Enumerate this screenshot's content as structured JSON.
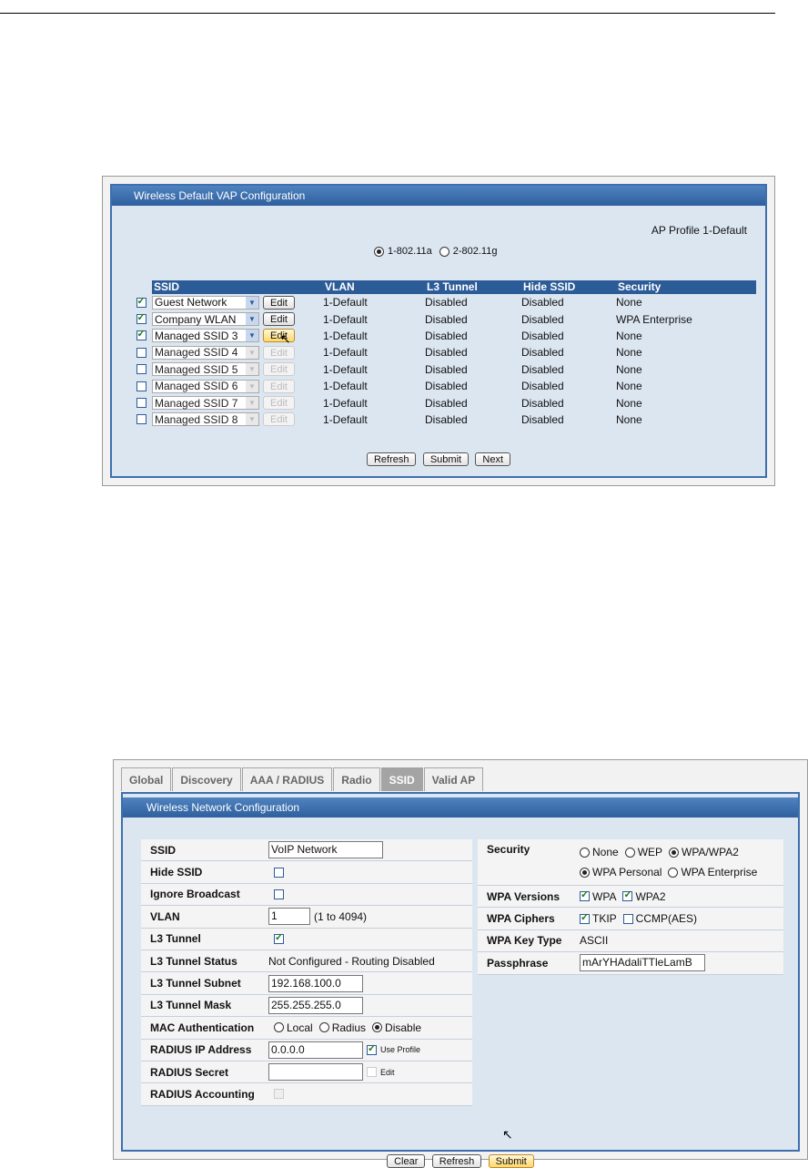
{
  "vap": {
    "title": "Wireless Default VAP Configuration",
    "ap_profile": "AP Profile 1-Default",
    "radio_a": "1-802.11a",
    "radio_g": "2-802.11g",
    "headers": {
      "ssid": "SSID",
      "vlan": "VLAN",
      "l3": "L3 Tunnel",
      "hide": "Hide SSID",
      "security": "Security"
    },
    "edit_label": "Edit",
    "rows": [
      {
        "ssid": "Guest Network",
        "vlan": "1-Default",
        "l3": "Disabled",
        "hide": "Disabled",
        "security": "None",
        "checked": true
      },
      {
        "ssid": "Company WLAN",
        "vlan": "1-Default",
        "l3": "Disabled",
        "hide": "Disabled",
        "security": "WPA Enterprise",
        "checked": true
      },
      {
        "ssid": "Managed SSID 3",
        "vlan": "1-Default",
        "l3": "Disabled",
        "hide": "Disabled",
        "security": "None",
        "checked": true
      },
      {
        "ssid": "Managed SSID 4",
        "vlan": "1-Default",
        "l3": "Disabled",
        "hide": "Disabled",
        "security": "None",
        "checked": false
      },
      {
        "ssid": "Managed SSID 5",
        "vlan": "1-Default",
        "l3": "Disabled",
        "hide": "Disabled",
        "security": "None",
        "checked": false
      },
      {
        "ssid": "Managed SSID 6",
        "vlan": "1-Default",
        "l3": "Disabled",
        "hide": "Disabled",
        "security": "None",
        "checked": false
      },
      {
        "ssid": "Managed SSID 7",
        "vlan": "1-Default",
        "l3": "Disabled",
        "hide": "Disabled",
        "security": "None",
        "checked": false
      },
      {
        "ssid": "Managed SSID 8",
        "vlan": "1-Default",
        "l3": "Disabled",
        "hide": "Disabled",
        "security": "None",
        "checked": false
      }
    ],
    "buttons": {
      "refresh": "Refresh",
      "submit": "Submit",
      "next": "Next"
    }
  },
  "net": {
    "tabs": [
      "Global",
      "Discovery",
      "AAA / RADIUS",
      "Radio",
      "SSID",
      "Valid AP"
    ],
    "active_tab": "SSID",
    "title": "Wireless Network Configuration",
    "left": {
      "ssid_label": "SSID",
      "ssid_value": "VoIP Network",
      "hide_label": "Hide SSID",
      "ignore_label": "Ignore Broadcast",
      "vlan_label": "VLAN",
      "vlan_value": "1",
      "vlan_range": "(1 to 4094)",
      "l3_label": "L3 Tunnel",
      "l3_status_label": "L3 Tunnel Status",
      "l3_status_value": "Not Configured - Routing Disabled",
      "l3_subnet_label": "L3 Tunnel Subnet",
      "l3_subnet_value": "192.168.100.0",
      "l3_mask_label": "L3 Tunnel Mask",
      "l3_mask_value": "255.255.255.0",
      "mac_label": "MAC Authentication",
      "mac_local": "Local",
      "mac_radius": "Radius",
      "mac_disable": "Disable",
      "radius_ip_label": "RADIUS IP Address",
      "radius_ip_value": "0.0.0.0",
      "use_profile": "Use Profile",
      "radius_secret_label": "RADIUS Secret",
      "edit": "Edit",
      "radius_acct_label": "RADIUS Accounting"
    },
    "right": {
      "security_label": "Security",
      "sec_none": "None",
      "sec_wep": "WEP",
      "sec_wpa": "WPA/WPA2",
      "wpa_personal": "WPA Personal",
      "wpa_enterprise": "WPA Enterprise",
      "versions_label": "WPA Versions",
      "ver_wpa": "WPA",
      "ver_wpa2": "WPA2",
      "ciphers_label": "WPA Ciphers",
      "cipher_tkip": "TKIP",
      "cipher_ccmp": "CCMP(AES)",
      "keytype_label": "WPA Key Type",
      "keytype_value": "ASCII",
      "passphrase_label": "Passphrase",
      "passphrase_value": "mArYHAdaliTTleLamB"
    },
    "buttons": {
      "clear": "Clear",
      "refresh": "Refresh",
      "submit": "Submit"
    }
  }
}
